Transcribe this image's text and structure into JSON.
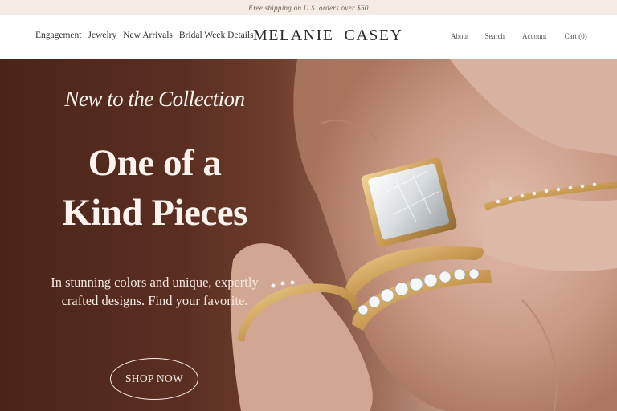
{
  "promo": {
    "text": "Free shipping on U.S. orders over $50"
  },
  "header": {
    "nav_left": [
      "Engagement",
      "Jewelry",
      "New Arrivals",
      "Bridal Week Details"
    ],
    "brand": "MELANIE  CASEY",
    "nav_right": {
      "about": "About",
      "search": "Search",
      "account": "Account",
      "cart": "Cart (0)"
    }
  },
  "hero": {
    "eyebrow": "New to the Collection",
    "title_line1": "One of a",
    "title_line2": "Kind Pieces",
    "subtitle_line1": "In stunning colors and unique, expertly",
    "subtitle_line2": "crafted designs. Find your favorite.",
    "cta": "SHOP NOW"
  },
  "colors": {
    "promo_bg": "#f4ece4",
    "hero_bg_dark": "#4a2419",
    "hero_text": "#fbf3ec",
    "gold": "#c9a060"
  }
}
